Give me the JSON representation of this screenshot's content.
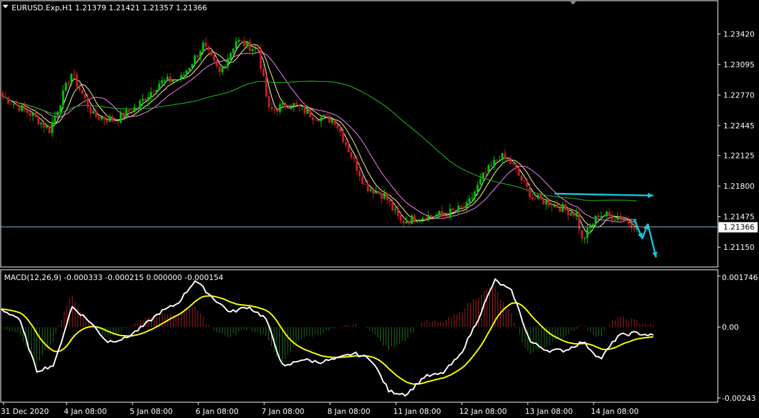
{
  "colors": {
    "background": "#000000",
    "grid_border": "#ffffff",
    "bull_candle": "#00c800",
    "bear_candle": "#c82020",
    "ma_fast": "#ffffff",
    "ma_mid": "#ffff80",
    "ma_slow": "#ff80ff",
    "ma_long": "#22c022",
    "macd_line": "#ffffff",
    "signal_line": "#ffff00",
    "hist_pos": "#a02020",
    "hist_neg": "#1e6e1e",
    "arrow": "#19c3d6",
    "price_line": "#8ab4c8"
  },
  "header": {
    "menu_icon": "triangle-down-icon",
    "title": "EURUSD.Exp,H1  1.21379 1.21421 1.21357 1.21366"
  },
  "macd_header": {
    "title": "MACD(12,26,9) -0.000333 -0.000215 0.000000 -0.000154"
  },
  "price_axis": {
    "ticks": [
      "1.23420",
      "1.23095",
      "1.22770",
      "1.22445",
      "1.22125",
      "1.21800",
      "1.21475",
      "1.21150"
    ],
    "current_label": "1.21366"
  },
  "macd_axis": {
    "ticks": [
      "0.001746",
      "0.00",
      "-0.00243"
    ]
  },
  "time_axis": {
    "labels": [
      "31 Dec 2020",
      "4 Jan 08:00",
      "5 Jan 08:00",
      "6 Jan 08:00",
      "7 Jan 08:00",
      "8 Jan 08:00",
      "11 Jan 08:00",
      "12 Jan 08:00",
      "13 Jan 08:00",
      "14 Jan 08:00"
    ]
  },
  "chart_data": {
    "type": "candlestick",
    "symbol": "EURUSD.Exp",
    "timeframe": "H1",
    "price_range": [
      1.2102,
      1.2362
    ],
    "current_price": 1.21366,
    "last_bar": {
      "open": 1.21379,
      "high": 1.21421,
      "low": 1.21357,
      "close": 1.21366
    },
    "price_path": [
      {
        "t": "31 Dec 2020",
        "price": 1.2288
      },
      {
        "t": "31 Dec 2020 18:00",
        "price": 1.2255
      },
      {
        "t": "4 Jan 00:00",
        "price": 1.224
      },
      {
        "t": "4 Jan 08:00",
        "price": 1.23
      },
      {
        "t": "4 Jan 16:00",
        "price": 1.2255
      },
      {
        "t": "5 Jan 00:00",
        "price": 1.225
      },
      {
        "t": "5 Jan 08:00",
        "price": 1.2265
      },
      {
        "t": "5 Jan 16:00",
        "price": 1.229
      },
      {
        "t": "6 Jan 00:00",
        "price": 1.2295
      },
      {
        "t": "6 Jan 08:00",
        "price": 1.233
      },
      {
        "t": "6 Jan 14:00",
        "price": 1.23
      },
      {
        "t": "6 Jan 20:00",
        "price": 1.2335
      },
      {
        "t": "7 Jan 04:00",
        "price": 1.2325
      },
      {
        "t": "7 Jan 08:00",
        "price": 1.226
      },
      {
        "t": "7 Jan 16:00",
        "price": 1.2268
      },
      {
        "t": "8 Jan 00:00",
        "price": 1.2255
      },
      {
        "t": "8 Jan 08:00",
        "price": 1.225
      },
      {
        "t": "8 Jan 16:00",
        "price": 1.22
      },
      {
        "t": "9 Jan 00:00",
        "price": 1.218
      },
      {
        "t": "11 Jan 02:00",
        "price": 1.217
      },
      {
        "t": "11 Jan 08:00",
        "price": 1.2142
      },
      {
        "t": "11 Jan 16:00",
        "price": 1.2148
      },
      {
        "t": "12 Jan 00:00",
        "price": 1.215
      },
      {
        "t": "12 Jan 08:00",
        "price": 1.2158
      },
      {
        "t": "12 Jan 14:00",
        "price": 1.219
      },
      {
        "t": "12 Jan 20:00",
        "price": 1.2212
      },
      {
        "t": "13 Jan 00:00",
        "price": 1.2205
      },
      {
        "t": "13 Jan 08:00",
        "price": 1.2168
      },
      {
        "t": "13 Jan 16:00",
        "price": 1.216
      },
      {
        "t": "14 Jan 00:00",
        "price": 1.215
      },
      {
        "t": "14 Jan 02:00",
        "price": 1.2122
      },
      {
        "t": "14 Jan 08:00",
        "price": 1.215
      },
      {
        "t": "14 Jan 16:00",
        "price": 1.2147
      },
      {
        "t": "14 Jan 22:00",
        "price": 1.21366
      }
    ],
    "moving_averages": [
      {
        "key": "ma_fast",
        "period": 4
      },
      {
        "key": "ma_mid",
        "period": 8
      },
      {
        "key": "ma_slow",
        "period": 16
      },
      {
        "key": "ma_long",
        "period": 70
      }
    ],
    "macd": {
      "params": "12,26,9",
      "range": [
        -0.00243,
        0.001746
      ],
      "macd_path": [
        0.0006,
        0.0003,
        -0.0015,
        -0.0013,
        0.0007,
        0.0002,
        -0.0005,
        -0.0004,
        0.0,
        0.0005,
        0.0008,
        0.0016,
        0.001,
        0.0005,
        0.0007,
        0.0003,
        -0.0014,
        -0.0011,
        -0.0012,
        -0.0011,
        -0.0009,
        -0.0011,
        -0.0022,
        -0.0023,
        -0.0017,
        -0.0016,
        -0.001,
        0.0002,
        0.0016,
        0.0012,
        -0.0005,
        -0.0008,
        -0.0008,
        -0.0005,
        -0.0011,
        -0.0003,
        -0.0002,
        -0.0003
      ],
      "signal_smoothing": 9
    },
    "projection_arrows": [
      {
        "from": {
          "t": "13 Jan 16:00",
          "price": 1.2172
        },
        "to": {
          "t": "15 Jan 04:00",
          "price": 1.217
        }
      },
      {
        "from": {
          "t": "14 Jan 21:00",
          "price": 1.2145
        },
        "to": {
          "t": "15 Jan 00:00",
          "price": 1.2124
        }
      },
      {
        "from": {
          "t": "15 Jan 00:00",
          "price": 1.2124
        },
        "to": {
          "t": "15 Jan 02:00",
          "price": 1.214
        }
      },
      {
        "from": {
          "t": "15 Jan 02:00",
          "price": 1.214
        },
        "to": {
          "t": "15 Jan 05:00",
          "price": 1.2104
        }
      }
    ]
  }
}
